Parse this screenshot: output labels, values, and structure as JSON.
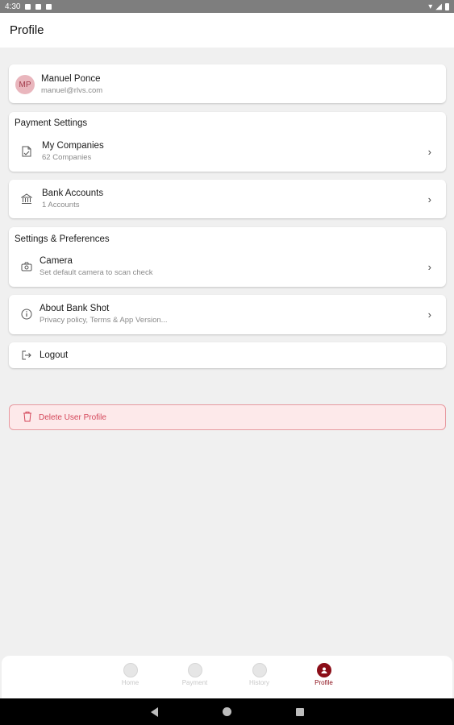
{
  "status_bar": {
    "time": "4:30"
  },
  "header": {
    "title": "Profile"
  },
  "user": {
    "initials": "MP",
    "name": "Manuel Ponce",
    "email": "manuel@rlvs.com"
  },
  "payment_settings": {
    "section_title": "Payment Settings",
    "my_companies": {
      "title": "My Companies",
      "subtitle": "62 Companies"
    },
    "bank_accounts": {
      "title": "Bank Accounts",
      "subtitle": "1 Accounts"
    }
  },
  "preferences": {
    "section_title": "Settings & Preferences",
    "camera": {
      "title": "Camera",
      "subtitle": "Set default camera to scan check"
    }
  },
  "about": {
    "title": "About Bank Shot",
    "subtitle": "Privacy policy, Terms & App Version..."
  },
  "logout": {
    "label": "Logout"
  },
  "delete_profile": {
    "label": "Delete User Profile"
  },
  "bottom_nav": {
    "items": [
      {
        "label": "Home",
        "icon": "home-icon"
      },
      {
        "label": "Payment",
        "icon": "payment-icon"
      },
      {
        "label": "History",
        "icon": "history-icon"
      },
      {
        "label": "Profile",
        "icon": "profile-icon",
        "active": true
      }
    ]
  },
  "colors": {
    "accent": "#8b0e18",
    "danger": "#d4475a",
    "danger_bg": "#fde9ea"
  }
}
